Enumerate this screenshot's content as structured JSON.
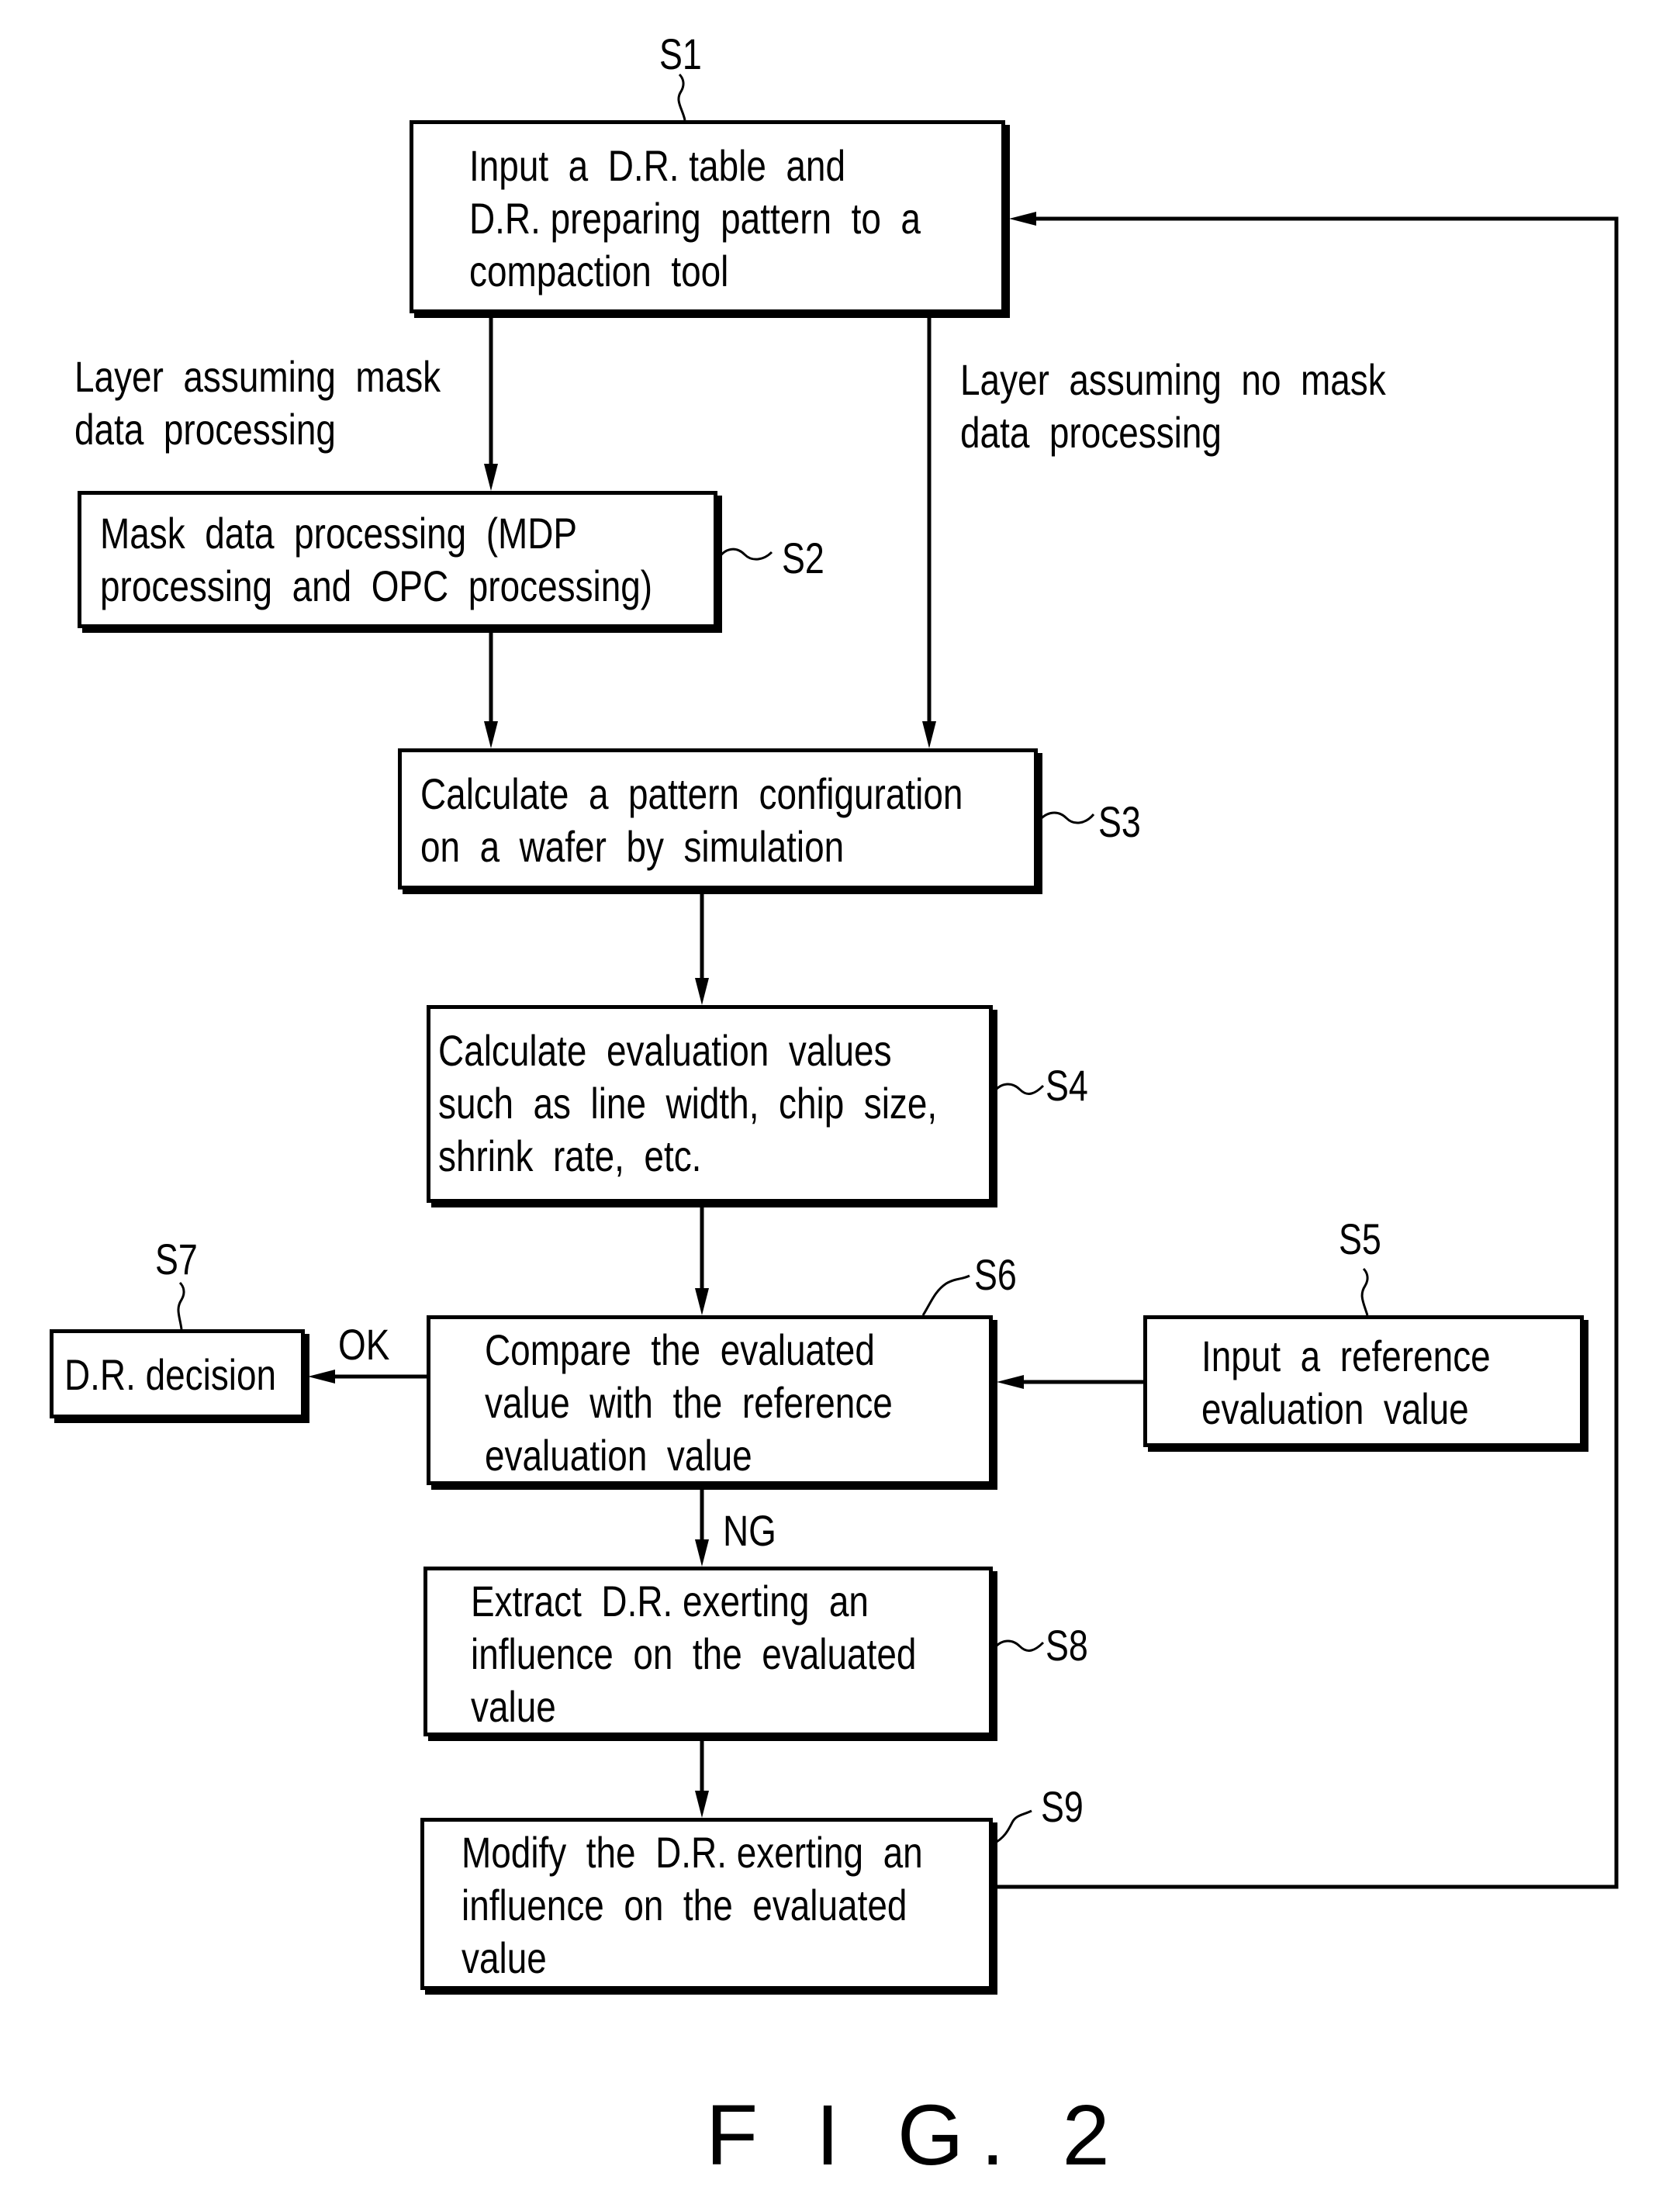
{
  "figure": {
    "caption": "F I G. 2"
  },
  "steps": {
    "s1": {
      "id": "S1",
      "lines": [
        "Input  a  D.R. table  and",
        "D.R. preparing  pattern  to  a",
        "compaction  tool"
      ]
    },
    "s2": {
      "id": "S2",
      "lines": [
        "Mask  data  processing  (MDP",
        "processing  and  OPC  processing)"
      ]
    },
    "s3": {
      "id": "S3",
      "lines": [
        "Calculate  a  pattern  configuration",
        "on  a  wafer  by  simulation"
      ]
    },
    "s4": {
      "id": "S4",
      "lines": [
        "Calculate  evaluation  values",
        "such  as  line  width,  chip  size,",
        "shrink  rate,  etc."
      ]
    },
    "s5": {
      "id": "S5",
      "lines": [
        "Input  a  reference",
        "evaluation  value"
      ]
    },
    "s6": {
      "id": "S6",
      "lines": [
        "Compare  the  evaluated",
        "value  with  the  reference",
        "evaluation  value"
      ]
    },
    "s7": {
      "id": "S7",
      "lines": [
        "D.R. decision"
      ]
    },
    "s8": {
      "id": "S8",
      "lines": [
        "Extract  D.R. exerting  an",
        "influence  on  the  evaluated",
        "value"
      ]
    },
    "s9": {
      "id": "S9",
      "lines": [
        "Modify  the  D.R. exerting  an",
        "influence  on  the  evaluated",
        "value"
      ]
    }
  },
  "branches": {
    "left_label": [
      "Layer  assuming  mask",
      "data  processing"
    ],
    "right_label": [
      "Layer  assuming  no  mask",
      "data  processing"
    ],
    "ok_label": "OK",
    "ng_label": "NG"
  }
}
